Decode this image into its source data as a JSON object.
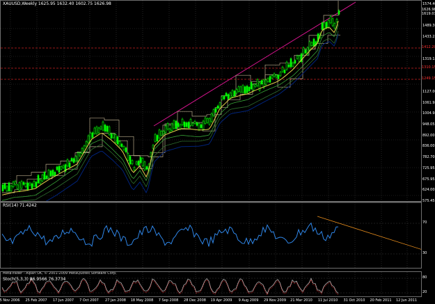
{
  "colors": {
    "background": "#000000",
    "candle_bull": "#00ff00",
    "ma_fast": "#e6d34a",
    "ma_mid": "#37a437",
    "ma_slow": "#00237a",
    "ichimoku": "#b8a98a",
    "trendline": "#d4148c",
    "rsi_line": "#2f86e8",
    "rsi_trend": "#e88d1c",
    "stoch": "#c0c0c0",
    "stoch_signal": "#b42020",
    "sr_line": "#cc2020",
    "grid": "#3a3a3a"
  },
  "main_pane": {
    "title": "XAUUSD,Weekly  1625.95 1632.40 1602.75 1626.98",
    "price_axis": [
      "1574.40",
      "1541.05",
      "1489.36",
      "1433.25",
      "1371.25",
      "1319.15",
      "1269.00",
      "1180.00",
      "1127.00",
      "1061.95",
      "1004.95",
      "948.05",
      "892.00",
      "836.00",
      "782.70",
      "725.95",
      "675.95",
      "624.00",
      "575.45"
    ],
    "price_tags": [
      {
        "text": "1626.98",
        "color": "#ffffff",
        "bg": "#000000"
      },
      {
        "text": "1619.03",
        "color": "#ffffff",
        "bg": "#000000"
      },
      {
        "text": "1412.20",
        "color": "#ff3030",
        "bg": "#000000"
      },
      {
        "text": "1310.15",
        "color": "#ff3030",
        "bg": "#000000"
      },
      {
        "text": "1249.15",
        "color": "#ff3030",
        "bg": "#000000"
      }
    ]
  },
  "rsi_pane": {
    "title": "RSI(14) 71.4242",
    "levels": [
      "70",
      "30"
    ]
  },
  "stoch_pane": {
    "title": "Stoch(5,3,3) 86.9566 76.3734",
    "levels": [
      "80",
      "20"
    ],
    "copyright": "MetaTrader - Alpari UK, © 2001-2009 MetaQuotes Software Corp."
  },
  "date_axis": [
    "5 Nov 2006",
    "25 Feb 2007",
    "17 Jun 2007",
    "7 Oct 2007",
    "27 Jan 2008",
    "18 May 2008",
    "7 Sep 2008",
    "28 Dec 2008",
    "19 Apr 2009",
    "9 Aug 2009",
    "29 Nov 2009",
    "21 Mar 2010",
    "11 Jul 2010",
    "31 Oct 2010",
    "20 Feb 2011",
    "12 Jun 2011"
  ]
}
